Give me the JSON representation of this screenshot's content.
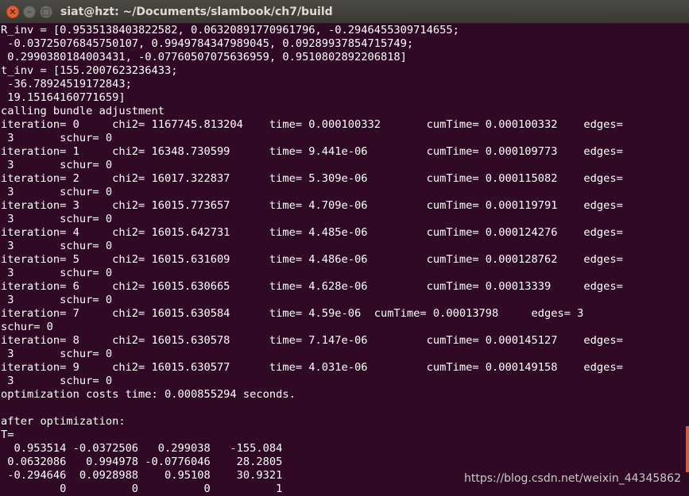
{
  "window": {
    "title": "siat@hzt: ~/Documents/slambook/ch7/build",
    "close_glyph": "×",
    "minimize_glyph": "–",
    "maximize_glyph": "□"
  },
  "terminal_lines": [
    "R_inv = [0.9535138403822582, 0.06320891770961796, -0.2946455309714655;",
    " -0.03725076845750107, 0.9949784347989045, 0.09289937854715749;",
    " 0.2990380184003431, -0.07760507075636959, 0.9510802892206818]",
    "t_inv = [155.2007623236433;",
    " -36.78924519172843;",
    " 19.15164160771659]",
    "calling bundle adjustment",
    "iteration= 0     chi2= 1167745.813204    time= 0.000100332       cumTime= 0.000100332    edges=",
    " 3       schur= 0",
    "iteration= 1     chi2= 16348.730599      time= 9.441e-06         cumTime= 0.000109773    edges=",
    " 3       schur= 0",
    "iteration= 2     chi2= 16017.322837      time= 5.309e-06         cumTime= 0.000115082    edges=",
    " 3       schur= 0",
    "iteration= 3     chi2= 16015.773657      time= 4.709e-06         cumTime= 0.000119791    edges=",
    " 3       schur= 0",
    "iteration= 4     chi2= 16015.642731      time= 4.485e-06         cumTime= 0.000124276    edges=",
    " 3       schur= 0",
    "iteration= 5     chi2= 16015.631609      time= 4.486e-06         cumTime= 0.000128762    edges=",
    " 3       schur= 0",
    "iteration= 6     chi2= 16015.630665      time= 4.628e-06         cumTime= 0.00013339     edges=",
    " 3       schur= 0",
    "iteration= 7     chi2= 16015.630584      time= 4.59e-06  cumTime= 0.00013798     edges= 3",
    "schur= 0",
    "iteration= 8     chi2= 16015.630578      time= 7.147e-06         cumTime= 0.000145127    edges=",
    " 3       schur= 0",
    "iteration= 9     chi2= 16015.630577      time= 4.031e-06         cumTime= 0.000149158    edges=",
    " 3       schur= 0",
    "optimization costs time: 0.000855294 seconds.",
    "",
    "after optimization:",
    "T=",
    "  0.953514 -0.0372506   0.299038   -155.084",
    " 0.0632086   0.994978 -0.0776046    28.2805",
    " -0.294646  0.0928988    0.95108    30.9321",
    "         0          0          0          1"
  ],
  "watermark": "https://blog.csdn.net/weixin_44345862",
  "colors": {
    "background": "#300a24",
    "text": "#ffffff",
    "titlebar": "#3c3b37",
    "close_button": "#e65c2e",
    "scroll_thumb": "#e4572e"
  }
}
